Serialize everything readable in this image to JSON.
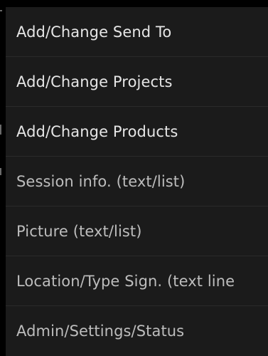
{
  "menu": {
    "items": [
      {
        "label": "Add/Change Send To"
      },
      {
        "label": "Add/Change Projects"
      },
      {
        "label": "Add/Change Products"
      },
      {
        "label": "Session info. (text/list)"
      },
      {
        "label": "Picture (text/list)"
      },
      {
        "label": "Location/Type Sign. (text line"
      },
      {
        "label": "Admin/Settings/Status"
      }
    ]
  },
  "colors": {
    "background": "#000000",
    "menu_background": "#1b1b1b",
    "divider": "#2a2a2a",
    "text": "#e6e6e6"
  }
}
